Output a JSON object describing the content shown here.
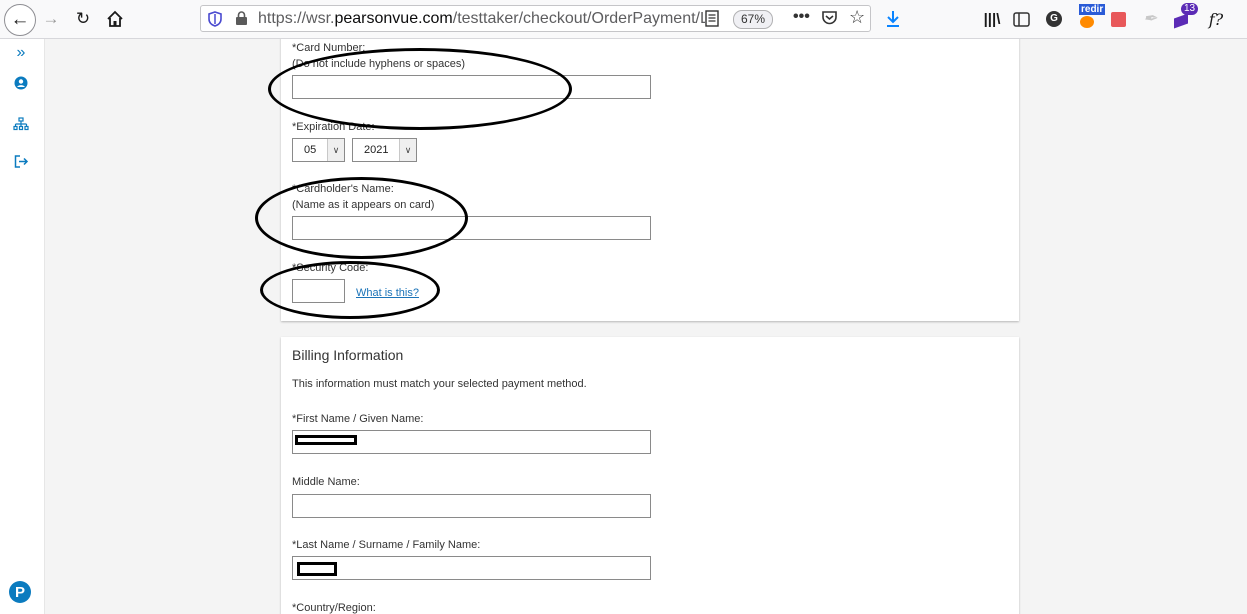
{
  "browser": {
    "url_prefix": "https://wsr.",
    "url_domain": "pearsonvue.com",
    "url_path": "/testtaker/checkout/OrderPayment/LINUXPF",
    "zoom": "67%",
    "badge_count": "13",
    "redir_label": "redir"
  },
  "payment": {
    "card_number_label": "*Card Number:",
    "card_number_hint": "(Do not include hyphens or spaces)",
    "card_number_value": "",
    "expiration_label": "*Expiration Date:",
    "exp_month": "05",
    "exp_year": "2021",
    "cardholder_label": "*Cardholder's Name:",
    "cardholder_hint": "(Name as it appears on card)",
    "cardholder_value": "",
    "security_label": "*Security Code:",
    "security_value": "",
    "what_is_this": "What is this?"
  },
  "billing": {
    "title": "Billing Information",
    "note": "This information must match your selected payment method.",
    "first_name_label": "*First Name / Given Name:",
    "middle_name_label": "Middle Name:",
    "middle_name_value": "",
    "last_name_label": "*Last Name / Surname / Family Name:",
    "country_label": "*Country/Region:"
  }
}
